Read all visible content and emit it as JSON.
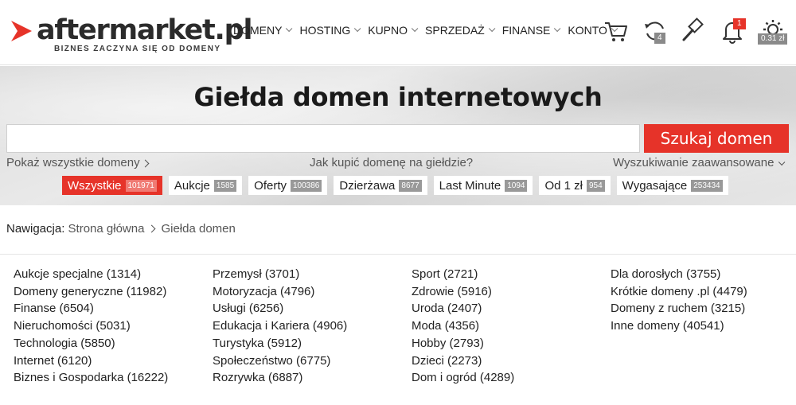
{
  "header": {
    "logo_text": "aftermarket.pl",
    "logo_tagline": "BIZNES ZACZYNA SIĘ OD DOMENY",
    "nav": [
      "DOMENY",
      "HOSTING",
      "KUPNO",
      "SPRZEDAŻ",
      "FINANSE",
      "KONTO"
    ],
    "refresh_badge": "4",
    "notifications_badge": "1",
    "balance_badge": "0.31 zł",
    "accent_color": "#e63329"
  },
  "hero": {
    "title": "Giełda domen internetowych",
    "search_value": "",
    "search_button": "Szukaj domen",
    "show_all_link": "Pokaż wszystkie domeny",
    "how_to_buy_link": "Jak kupić domenę na giełdzie?",
    "advanced_search_link": "Wyszukiwanie zaawansowane"
  },
  "filters": [
    {
      "label": "Wszystkie",
      "count": "101971",
      "active": true
    },
    {
      "label": "Aukcje",
      "count": "1585",
      "active": false
    },
    {
      "label": "Oferty",
      "count": "100386",
      "active": false
    },
    {
      "label": "Dzierżawa",
      "count": "8677",
      "active": false
    },
    {
      "label": "Last Minute",
      "count": "1094",
      "active": false
    },
    {
      "label": "Od 1 zł",
      "count": "954",
      "active": false
    },
    {
      "label": "Wygasające",
      "count": "253434",
      "active": false
    }
  ],
  "breadcrumb": {
    "label": "Nawigacja:",
    "home": "Strona główna",
    "current": "Giełda domen"
  },
  "categories": [
    [
      "Aukcje specjalne (1314)",
      "Domeny generyczne (11982)",
      "Finanse (6504)",
      "Nieruchomości (5031)",
      "Technologia (5850)",
      "Internet (6120)",
      "Biznes i Gospodarka (16222)"
    ],
    [
      "Przemysł (3701)",
      "Motoryzacja (4796)",
      "Usługi (6256)",
      "Edukacja i Kariera (4906)",
      "Turystyka (5912)",
      "Społeczeństwo (6775)",
      "Rozrywka (6887)"
    ],
    [
      "Sport (2721)",
      "Zdrowie (5916)",
      "Uroda (2407)",
      "Moda (4356)",
      "Hobby (2793)",
      "Dzieci (2273)",
      "Dom i ogród (4289)"
    ],
    [
      "Dla dorosłych (3755)",
      "Krótkie domeny .pl (4479)",
      "Domeny z ruchem (3215)",
      "Inne domeny (40541)"
    ]
  ]
}
